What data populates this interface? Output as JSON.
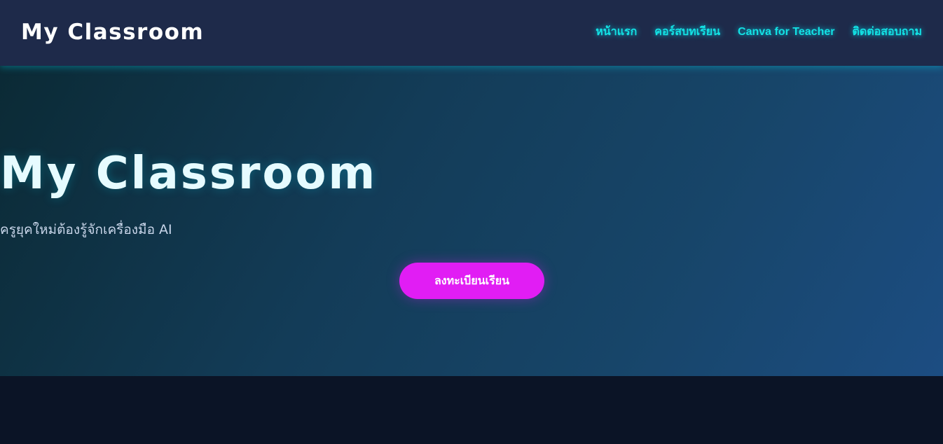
{
  "header": {
    "brand": "My Classroom",
    "nav": [
      {
        "label": "หน้าแรก"
      },
      {
        "label": "คอร์สบทเรียน"
      },
      {
        "label": "Canva for Teacher"
      },
      {
        "label": "ติดต่อสอบถาม"
      }
    ]
  },
  "hero": {
    "title": "My Classroom",
    "subtitle": "ครูยุคใหม่ต้องรู้จักเครื่องมือ AI",
    "cta_label": "ลงทะเบียนเรียน"
  },
  "colors": {
    "header_bg": "#1e2a4a",
    "accent_cyan": "#13e2e4",
    "cta_magenta": "#e11df4",
    "page_bg": "#0b1426"
  }
}
